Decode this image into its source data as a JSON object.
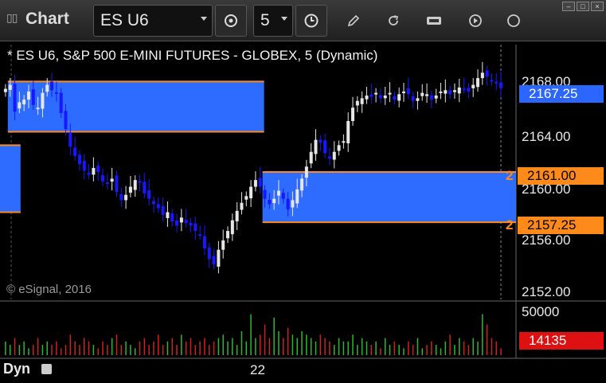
{
  "toolbar": {
    "title": "Chart",
    "symbol": "ES U6",
    "interval": "5",
    "icons": [
      "link-icon",
      "clock-icon",
      "pencil-icon",
      "refresh-icon",
      "get-icon",
      "play-icon"
    ]
  },
  "chart": {
    "title": "* ES U6, S&P 500 E-MINI FUTURES - GLOBEX, 5 (Dynamic)",
    "copyright": "© eSignal, 2016",
    "price_ticks": [
      "2168.00",
      "2164.00",
      "2160.00",
      "2156.00",
      "2152.00"
    ],
    "volume_tick": "50000",
    "x_label": "22",
    "status": "Dyn",
    "last_price": "2167.25",
    "volume_last": "14135",
    "levels": [
      {
        "price": "2161.00",
        "count": "2"
      },
      {
        "price": "2157.25",
        "count": "2"
      }
    ],
    "colors": {
      "up": "#e6e6e6",
      "down": "#1818ff",
      "zone": "#2e6bff",
      "line": "#ff8a1c",
      "vol_up": "#2db82d",
      "vol_down": "#cc2222"
    }
  },
  "chart_data": {
    "type": "candlestick",
    "ylim": [
      2151.5,
      2170.5
    ],
    "y_ticks": [
      2168,
      2164,
      2160,
      2156,
      2152
    ],
    "zones": [
      {
        "top": 2167.75,
        "bottom": 2164.0,
        "from_bar": 1,
        "to_bar": 56
      },
      {
        "top": 2163.0,
        "bottom": 2158.0,
        "from_bar": 0,
        "to_bar": 1
      },
      {
        "top": 2161.0,
        "bottom": 2157.25,
        "from_bar": 56,
        "to_bar": 108
      }
    ],
    "close_path": [
      2167.2,
      2167.5,
      2165.5,
      2166.2,
      2166.4,
      2167.0,
      2166.0,
      2165.8,
      2166.9,
      2167.5,
      2167.1,
      2166.9,
      2165.4,
      2164.2,
      2162.9,
      2162.2,
      2161.6,
      2161.1,
      2160.8,
      2161.3,
      2161.0,
      2160.3,
      2160.2,
      2160.5,
      2159.5,
      2158.9,
      2159.3,
      2159.9,
      2160.4,
      2160.2,
      2159.4,
      2159.0,
      2158.6,
      2158.3,
      2157.8,
      2158.0,
      2157.3,
      2157.0,
      2157.6,
      2157.2,
      2157.0,
      2156.6,
      2156.3,
      2155.3,
      2154.5,
      2154.1,
      2155.2,
      2155.9,
      2156.6,
      2157.4,
      2158.1,
      2158.7,
      2159.2,
      2159.9,
      2160.4,
      2159.9,
      2159.0,
      2158.6,
      2159.0,
      2159.6,
      2159.0,
      2158.2,
      2158.9,
      2159.7,
      2160.5,
      2161.4,
      2162.5,
      2163.4,
      2163.2,
      2162.4,
      2162.0,
      2162.5,
      2163.0,
      2163.3,
      2164.8,
      2165.8,
      2166.3,
      2166.5,
      2166.7,
      2166.6,
      2166.9,
      2166.5,
      2166.7,
      2166.9,
      2166.4,
      2166.8,
      2167.0,
      2166.8,
      2166.3,
      2166.5,
      2166.9,
      2166.8,
      2166.4,
      2166.7,
      2167.0,
      2167.1,
      2166.8,
      2167.1,
      2167.3,
      2167.2,
      2167.0,
      2167.5,
      2168.0,
      2168.4,
      2168.1,
      2167.8,
      2167.6,
      2167.25
    ],
    "volume": [
      4,
      3,
      5,
      3,
      4,
      2,
      3,
      5,
      3,
      4,
      3,
      4,
      2,
      3,
      6,
      4,
      3,
      5,
      4,
      3,
      2,
      4,
      3,
      5,
      6,
      3,
      4,
      3,
      2,
      4,
      5,
      3,
      4,
      6,
      3,
      4,
      5,
      3,
      6,
      4,
      5,
      3,
      4,
      5,
      3,
      4,
      5,
      6,
      4,
      5,
      3,
      7,
      4,
      12,
      5,
      6,
      9,
      5,
      11,
      7,
      5,
      8,
      6,
      5,
      7,
      6,
      5,
      4,
      6,
      5,
      4,
      3,
      5,
      4,
      4,
      6,
      3,
      5,
      4,
      3,
      4,
      2,
      5,
      3,
      4,
      3,
      2,
      4,
      3,
      5,
      2,
      3,
      4,
      3,
      2,
      4,
      6,
      3,
      5,
      4,
      3,
      5,
      4,
      12,
      9,
      5,
      4,
      2
    ]
  }
}
